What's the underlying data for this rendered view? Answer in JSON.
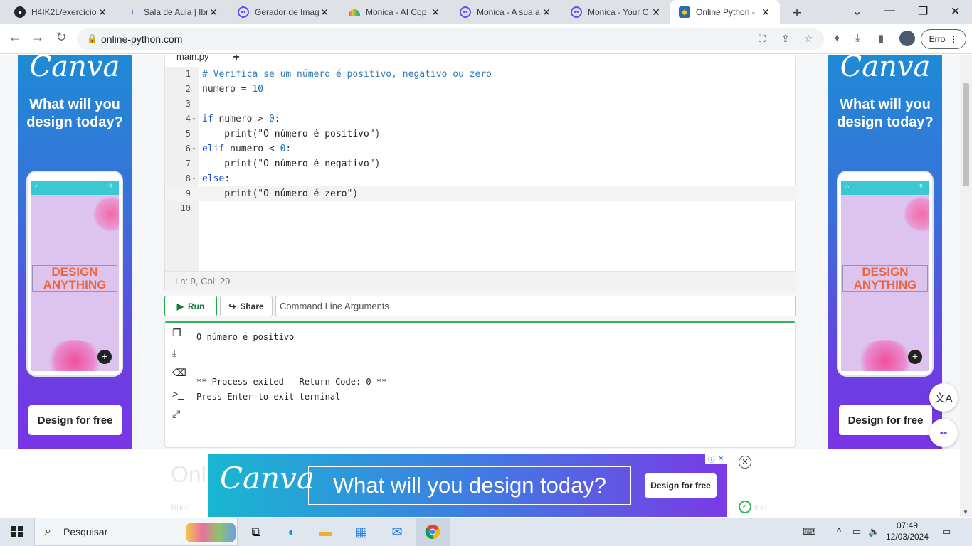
{
  "browser": {
    "tabs": [
      {
        "title": "H4IK2L/exercício",
        "icon": "github-icon"
      },
      {
        "title": "Sala de Aula | Ibm",
        "icon": "info-icon"
      },
      {
        "title": "Gerador de Imag",
        "icon": "monica-icon"
      },
      {
        "title": "Monica - AI Cop",
        "icon": "rainbow-icon"
      },
      {
        "title": "Monica - A sua a",
        "icon": "monica-icon"
      },
      {
        "title": "Monica - Your C",
        "icon": "monica-icon"
      },
      {
        "title": "Online Python -",
        "icon": "python-icon",
        "active": true
      }
    ],
    "url": "online-python.com",
    "error_label": "Erro"
  },
  "ads": {
    "side_logo": "Canva",
    "side_headline": "What will you design today?",
    "phone_text": "DESIGN ANYTHING",
    "side_cta": "Design for free",
    "banner_logo": "Canva",
    "banner_headline": "What will you design today?",
    "banner_cta": "Design for free"
  },
  "editor": {
    "filename": "main.py",
    "add_tab": "+",
    "status": "Ln: 9,  Col: 29",
    "lines": [
      {
        "n": "1",
        "text": "# Verifica se um número é positivo, negativo ou zero"
      },
      {
        "n": "2",
        "text": "numero = 10"
      },
      {
        "n": "3",
        "text": ""
      },
      {
        "n": "4",
        "text": "if numero > 0:",
        "fold": true
      },
      {
        "n": "5",
        "text": "    print(\"O número é positivo\")"
      },
      {
        "n": "6",
        "text": "elif numero < 0:",
        "fold": true
      },
      {
        "n": "7",
        "text": "    print(\"O número é negativo\")"
      },
      {
        "n": "8",
        "text": "else:",
        "fold": true
      },
      {
        "n": "9",
        "text": "    print(\"O número é zero\")",
        "active": true
      },
      {
        "n": "10",
        "text": ""
      }
    ]
  },
  "controls": {
    "run_label": "Run",
    "share_label": "Share",
    "args_placeholder": "Command Line Arguments"
  },
  "terminal": {
    "output": "O número é positivo\n\n\n** Process exited - Return Code: 0 **\nPress Enter to exit terminal"
  },
  "page_below": {
    "title": "Onl",
    "text_left": "Build,",
    "text_right": "it is"
  },
  "taskbar": {
    "search_label": "Pesquisar",
    "time": "07:49",
    "date": "12/03/2024"
  }
}
